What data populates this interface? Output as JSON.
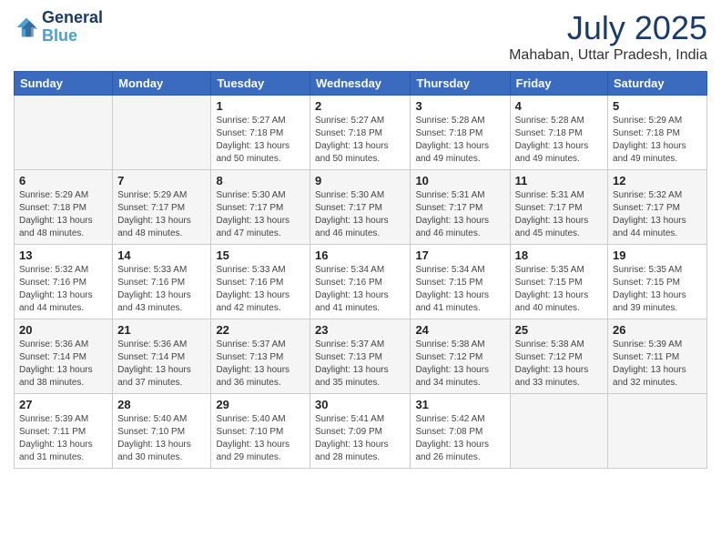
{
  "header": {
    "logo_line1": "General",
    "logo_line2": "Blue",
    "month": "July 2025",
    "location": "Mahaban, Uttar Pradesh, India"
  },
  "days_of_week": [
    "Sunday",
    "Monday",
    "Tuesday",
    "Wednesday",
    "Thursday",
    "Friday",
    "Saturday"
  ],
  "weeks": [
    [
      {
        "day": "",
        "info": ""
      },
      {
        "day": "",
        "info": ""
      },
      {
        "day": "1",
        "info": "Sunrise: 5:27 AM\nSunset: 7:18 PM\nDaylight: 13 hours and 50 minutes."
      },
      {
        "day": "2",
        "info": "Sunrise: 5:27 AM\nSunset: 7:18 PM\nDaylight: 13 hours and 50 minutes."
      },
      {
        "day": "3",
        "info": "Sunrise: 5:28 AM\nSunset: 7:18 PM\nDaylight: 13 hours and 49 minutes."
      },
      {
        "day": "4",
        "info": "Sunrise: 5:28 AM\nSunset: 7:18 PM\nDaylight: 13 hours and 49 minutes."
      },
      {
        "day": "5",
        "info": "Sunrise: 5:29 AM\nSunset: 7:18 PM\nDaylight: 13 hours and 49 minutes."
      }
    ],
    [
      {
        "day": "6",
        "info": "Sunrise: 5:29 AM\nSunset: 7:18 PM\nDaylight: 13 hours and 48 minutes."
      },
      {
        "day": "7",
        "info": "Sunrise: 5:29 AM\nSunset: 7:17 PM\nDaylight: 13 hours and 48 minutes."
      },
      {
        "day": "8",
        "info": "Sunrise: 5:30 AM\nSunset: 7:17 PM\nDaylight: 13 hours and 47 minutes."
      },
      {
        "day": "9",
        "info": "Sunrise: 5:30 AM\nSunset: 7:17 PM\nDaylight: 13 hours and 46 minutes."
      },
      {
        "day": "10",
        "info": "Sunrise: 5:31 AM\nSunset: 7:17 PM\nDaylight: 13 hours and 46 minutes."
      },
      {
        "day": "11",
        "info": "Sunrise: 5:31 AM\nSunset: 7:17 PM\nDaylight: 13 hours and 45 minutes."
      },
      {
        "day": "12",
        "info": "Sunrise: 5:32 AM\nSunset: 7:17 PM\nDaylight: 13 hours and 44 minutes."
      }
    ],
    [
      {
        "day": "13",
        "info": "Sunrise: 5:32 AM\nSunset: 7:16 PM\nDaylight: 13 hours and 44 minutes."
      },
      {
        "day": "14",
        "info": "Sunrise: 5:33 AM\nSunset: 7:16 PM\nDaylight: 13 hours and 43 minutes."
      },
      {
        "day": "15",
        "info": "Sunrise: 5:33 AM\nSunset: 7:16 PM\nDaylight: 13 hours and 42 minutes."
      },
      {
        "day": "16",
        "info": "Sunrise: 5:34 AM\nSunset: 7:16 PM\nDaylight: 13 hours and 41 minutes."
      },
      {
        "day": "17",
        "info": "Sunrise: 5:34 AM\nSunset: 7:15 PM\nDaylight: 13 hours and 41 minutes."
      },
      {
        "day": "18",
        "info": "Sunrise: 5:35 AM\nSunset: 7:15 PM\nDaylight: 13 hours and 40 minutes."
      },
      {
        "day": "19",
        "info": "Sunrise: 5:35 AM\nSunset: 7:15 PM\nDaylight: 13 hours and 39 minutes."
      }
    ],
    [
      {
        "day": "20",
        "info": "Sunrise: 5:36 AM\nSunset: 7:14 PM\nDaylight: 13 hours and 38 minutes."
      },
      {
        "day": "21",
        "info": "Sunrise: 5:36 AM\nSunset: 7:14 PM\nDaylight: 13 hours and 37 minutes."
      },
      {
        "day": "22",
        "info": "Sunrise: 5:37 AM\nSunset: 7:13 PM\nDaylight: 13 hours and 36 minutes."
      },
      {
        "day": "23",
        "info": "Sunrise: 5:37 AM\nSunset: 7:13 PM\nDaylight: 13 hours and 35 minutes."
      },
      {
        "day": "24",
        "info": "Sunrise: 5:38 AM\nSunset: 7:12 PM\nDaylight: 13 hours and 34 minutes."
      },
      {
        "day": "25",
        "info": "Sunrise: 5:38 AM\nSunset: 7:12 PM\nDaylight: 13 hours and 33 minutes."
      },
      {
        "day": "26",
        "info": "Sunrise: 5:39 AM\nSunset: 7:11 PM\nDaylight: 13 hours and 32 minutes."
      }
    ],
    [
      {
        "day": "27",
        "info": "Sunrise: 5:39 AM\nSunset: 7:11 PM\nDaylight: 13 hours and 31 minutes."
      },
      {
        "day": "28",
        "info": "Sunrise: 5:40 AM\nSunset: 7:10 PM\nDaylight: 13 hours and 30 minutes."
      },
      {
        "day": "29",
        "info": "Sunrise: 5:40 AM\nSunset: 7:10 PM\nDaylight: 13 hours and 29 minutes."
      },
      {
        "day": "30",
        "info": "Sunrise: 5:41 AM\nSunset: 7:09 PM\nDaylight: 13 hours and 28 minutes."
      },
      {
        "day": "31",
        "info": "Sunrise: 5:42 AM\nSunset: 7:08 PM\nDaylight: 13 hours and 26 minutes."
      },
      {
        "day": "",
        "info": ""
      },
      {
        "day": "",
        "info": ""
      }
    ]
  ]
}
